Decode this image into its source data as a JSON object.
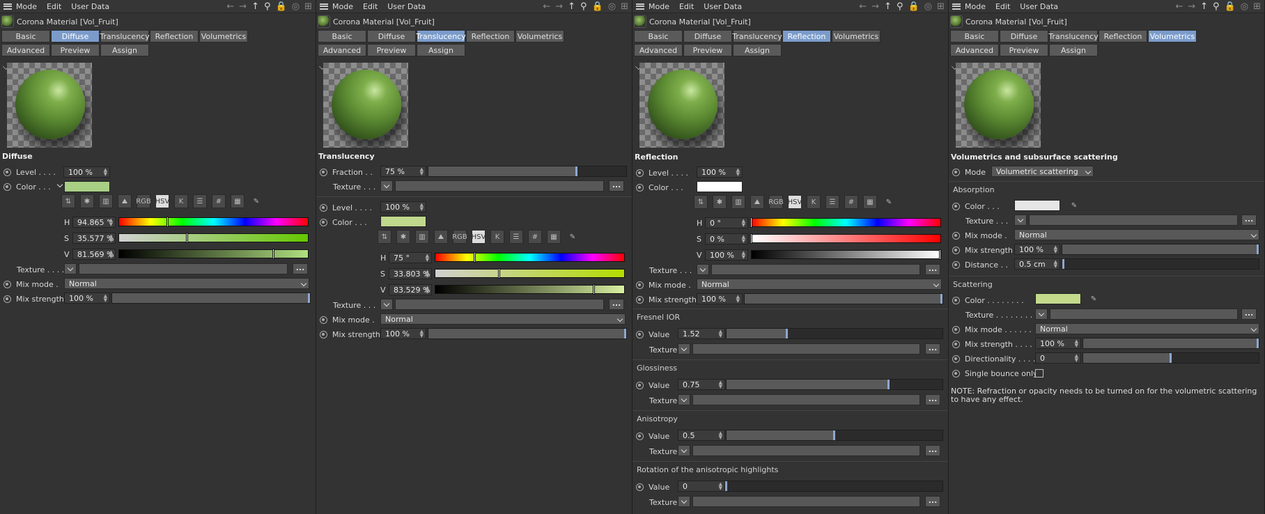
{
  "menu": {
    "mode": "Mode",
    "edit": "Edit",
    "user_data": "User Data"
  },
  "title": "Corona Material [Vol_Fruit]",
  "tabs": {
    "basic": "Basic",
    "diffuse": "Diffuse",
    "translucency": "Translucency",
    "reflection": "Reflection",
    "volumetrics": "Volumetrics",
    "advanced": "Advanced",
    "preview": "Preview",
    "assign": "Assign"
  },
  "tool_labels": {
    "rgb": "RGB",
    "hsv": "HSV",
    "k": "K",
    "hash": "#"
  },
  "panel1": {
    "section": "Diffuse",
    "level_label": "Level . . . .",
    "level": "100 %",
    "color_label": "Color . . .",
    "color": "#a8cf84",
    "h_label": "H",
    "h": "94.865 °",
    "s_label": "S",
    "s": "35.577 %",
    "v_label": "V",
    "v": "81.569 %",
    "h_frac": 0.26,
    "s_frac": 0.36,
    "v_frac": 0.82,
    "texture_label": "Texture . . . .",
    "dots": "...",
    "mix_mode_label": "Mix mode .",
    "mix_mode": "Normal",
    "mix_strength_label": "Mix strength",
    "mix_strength": "100 %"
  },
  "panel2": {
    "section": "Translucency",
    "fraction_label": "Fraction . .",
    "fraction": "75 %",
    "fraction_frac": 0.75,
    "texture_label": "Texture . . .",
    "level_label": "Level . . . .",
    "level": "100 %",
    "color_label": "Color . . .",
    "color": "#bfd88c",
    "h_label": "H",
    "h": "75 °",
    "s_label": "S",
    "s": "33.803 %",
    "v_label": "V",
    "v": "83.529 %",
    "h_frac": 0.21,
    "s_frac": 0.34,
    "v_frac": 0.84,
    "texture2_label": "Texture . . .",
    "dots": "...",
    "mix_mode_label": "Mix mode .",
    "mix_mode": "Normal",
    "mix_strength_label": "Mix strength",
    "mix_strength": "100 %"
  },
  "panel3": {
    "section": "Reflection",
    "level_label": "Level . . . .",
    "level": "100 %",
    "color_label": "Color . . .",
    "color": "#ffffff",
    "h_label": "H",
    "h": "0 °",
    "s_label": "S",
    "s": "0 %",
    "v_label": "V",
    "v": "100 %",
    "h_frac": 0.0,
    "s_frac": 0.0,
    "v_frac": 1.0,
    "texture_label": "Texture . . .",
    "dots": "...",
    "mix_mode_label": "Mix mode .",
    "mix_mode": "Normal",
    "mix_strength_label": "Mix strength",
    "mix_strength": "100 %",
    "fresnel_group": "Fresnel IOR",
    "fresnel_value": "1.52",
    "fresnel_frac": 0.28,
    "gloss_group": "Glossiness",
    "gloss_value": "0.75",
    "gloss_frac": 0.75,
    "aniso_group": "Anisotropy",
    "aniso_value": "0.5",
    "aniso_frac": 0.5,
    "rot_group": "Rotation of the anisotropic highlights",
    "rot_value": "0",
    "rot_frac": 0.0,
    "value_label": "Value",
    "texture_short": "Texture"
  },
  "panel4": {
    "section": "Volumetrics and subsurface scattering",
    "mode_label": "Mode",
    "mode": "Volumetric scattering",
    "absorption": "Absorption",
    "color_label": "Color . . .",
    "abs_color": "#e6e6e6",
    "texture_label": "Texture . . .",
    "mix_mode_label": "Mix mode .",
    "mix_mode": "Normal",
    "mix_strength_label": "Mix strength",
    "mix_strength": "100 %",
    "distance_label": "Distance . .",
    "distance": "0.5 cm",
    "scattering": "Scattering",
    "sc_color_label": "Color . . . . . . . .",
    "sc_color": "#c3d98c",
    "sc_texture_label": "Texture . . . . . . . .",
    "sc_mix_mode_label": "Mix mode . . . . . .",
    "sc_mix_mode": "Normal",
    "sc_mix_strength_label": "Mix strength . . . .",
    "sc_mix_strength": "100 %",
    "direction_label": "Directionality . . . .",
    "direction": "0",
    "direction_frac": 0.5,
    "single_bounce_label": "Single bounce only",
    "note": "NOTE: Refraction or opacity needs to be turned on for the volumetric scattering to have any effect.",
    "dots": "..."
  }
}
